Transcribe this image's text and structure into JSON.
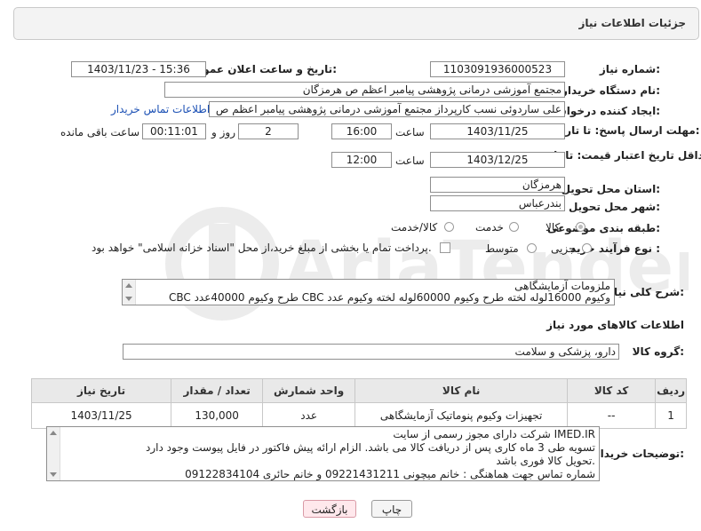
{
  "panel": {
    "title": "جزئیات اطلاعات نیاز"
  },
  "fields": {
    "need_number": {
      "label": "شماره نیاز:",
      "value": "1103091936000523"
    },
    "announce_datetime": {
      "label": "تاریخ و ساعت اعلان عمومی:",
      "value": "1403/11/23 - 15:36"
    },
    "buyer_org": {
      "label": "نام دستگاه خریدار:",
      "value": "مجتمع آموزشی درمانی پژوهشی پیامبر اعظم ص  هرمزگان"
    },
    "requester": {
      "label": "ایجاد کننده درخواست:",
      "value": "علی ساردوئی نسب کارپرداز مجتمع آموزشی درمانی پژوهشی پیامبر اعظم ص"
    },
    "buyer_contact_link": "اطلاعات تماس خریدار",
    "reply_deadline": {
      "label": "مهلت ارسال پاسخ: تا تاریخ:",
      "date": "1403/11/25",
      "time_label": "ساعت",
      "time": "16:00",
      "days": "2",
      "days_label": "روز و",
      "remaining": "00:11:01",
      "remaining_label": "ساعت باقی مانده"
    },
    "price_validity": {
      "label": "حداقل تاریخ اعتبار قیمت: تا تاریخ:",
      "date": "1403/12/25",
      "time_label": "ساعت",
      "time": "12:00"
    },
    "province": {
      "label": "استان محل تحویل:",
      "value": "هرمزگان"
    },
    "city": {
      "label": "شهر محل تحویل:",
      "value": "بندرعباس"
    },
    "category": {
      "label": "طبقه بندی موضوعی:",
      "options": [
        "کالا",
        "خدمت",
        "کالا/خدمت"
      ],
      "selected": "کالا"
    },
    "purchase_type": {
      "label": "نوع فرآیند خرید :",
      "options": [
        "جزیی",
        "متوسط"
      ],
      "note": "پرداخت تمام یا بخشی از مبلغ خرید،از محل \"اسناد خزانه اسلامی\" خواهد بود."
    }
  },
  "description": {
    "label": "شرح کلی نیاز:",
    "line1": "ملزومات آزمایشگاهی",
    "line2": "CBC طرح وکیوم     40000عدد CBC وکیوم 16000لوله لخته طرح وکیوم  60000لوله لخته وکیوم عدد"
  },
  "goods_info": {
    "heading": "اطلاعات کالاهای مورد نیاز",
    "group_label": "گروه کالا:",
    "group_value": "دارو، پزشکی و سلامت"
  },
  "table": {
    "headers": [
      "ردیف",
      "کد کالا",
      "نام کالا",
      "واحد شمارش",
      "تعداد / مقدار",
      "تاریخ نیاز"
    ],
    "rows": [
      [
        "1",
        "--",
        "تجهیزات وکیوم پنوماتیک آزمایشگاهی",
        "عدد",
        "130,000",
        "1403/11/25"
      ]
    ]
  },
  "buyer_notes": {
    "label": "توضیحات خریدار:",
    "lines": [
      "شرکت دارای مجوز رسمی از سایت IMED.IR",
      "  تسویه طی 3 ماه  کاری پس از دریافت کالا می باشد.  الزام ارائه پیش فاکتور در فایل پیوست وجود دارد",
      "تحویل کالا فوری باشد.",
      "شماره تماس جهت هماهنگی : خانم میچونی 09221431211 و خانم حائری 09122834104"
    ]
  },
  "buttons": {
    "print": "چاپ",
    "back": "بازگشت"
  },
  "watermark": "AriaTender.neT"
}
